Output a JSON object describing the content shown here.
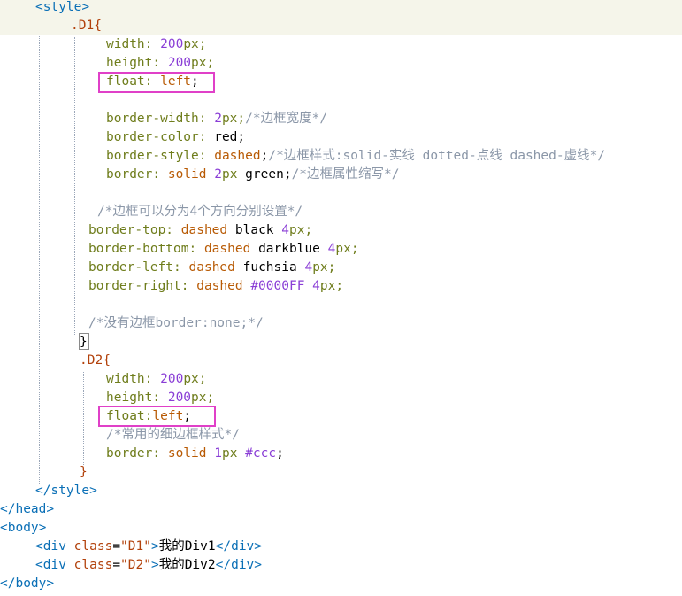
{
  "lines": [
    {
      "ind": 40,
      "hl": true,
      "tokens": [
        [
          "tag",
          "<style>"
        ]
      ]
    },
    {
      "ind": 80,
      "hl": true,
      "tokens": [
        [
          "sel",
          ".D1{"
        ]
      ]
    },
    {
      "ind": 120,
      "tokens": [
        [
          "prop",
          "width: "
        ],
        [
          "num",
          "200"
        ],
        [
          "prop",
          "px;"
        ]
      ]
    },
    {
      "ind": 120,
      "tokens": [
        [
          "prop",
          "height: "
        ],
        [
          "num",
          "200"
        ],
        [
          "prop",
          "px;"
        ]
      ]
    },
    {
      "ind": 120,
      "tokens": [
        [
          "prop",
          "float: "
        ],
        [
          "val",
          "left"
        ],
        [
          "plain",
          ";"
        ]
      ]
    },
    {
      "ind": 120,
      "tokens": []
    },
    {
      "ind": 120,
      "tokens": [
        [
          "prop",
          "border-width: "
        ],
        [
          "num",
          "2"
        ],
        [
          "prop",
          "px;"
        ],
        [
          "cm",
          "/*边框宽度*/"
        ]
      ]
    },
    {
      "ind": 120,
      "tokens": [
        [
          "prop",
          "border-color: "
        ],
        [
          "plain",
          "red;"
        ]
      ]
    },
    {
      "ind": 120,
      "tokens": [
        [
          "prop",
          "border-style: "
        ],
        [
          "val",
          "dashed"
        ],
        [
          "plain",
          ";"
        ],
        [
          "cm",
          "/*边框样式:solid-实线 dotted-点线 dashed-虚线*/"
        ]
      ]
    },
    {
      "ind": 120,
      "tokens": [
        [
          "prop",
          "border: "
        ],
        [
          "val",
          "solid "
        ],
        [
          "num",
          "2"
        ],
        [
          "prop",
          "px "
        ],
        [
          "plain",
          "green;"
        ],
        [
          "cm",
          "/*边框属性缩写*/"
        ]
      ]
    },
    {
      "ind": 120,
      "tokens": []
    },
    {
      "ind": 110,
      "tokens": [
        [
          "cm",
          "/*边框可以分为4个方向分别设置*/"
        ]
      ]
    },
    {
      "ind": 100,
      "tokens": [
        [
          "prop",
          "border-top: "
        ],
        [
          "val",
          "dashed "
        ],
        [
          "plain",
          "black "
        ],
        [
          "num",
          "4"
        ],
        [
          "prop",
          "px;"
        ]
      ]
    },
    {
      "ind": 100,
      "tokens": [
        [
          "prop",
          "border-bottom: "
        ],
        [
          "val",
          "dashed "
        ],
        [
          "plain",
          "darkblue "
        ],
        [
          "num",
          "4"
        ],
        [
          "prop",
          "px;"
        ]
      ]
    },
    {
      "ind": 100,
      "tokens": [
        [
          "prop",
          "border-left: "
        ],
        [
          "val",
          "dashed "
        ],
        [
          "plain",
          "fuchsia "
        ],
        [
          "num",
          "4"
        ],
        [
          "prop",
          "px;"
        ]
      ]
    },
    {
      "ind": 100,
      "tokens": [
        [
          "prop",
          "border-right: "
        ],
        [
          "val",
          "dashed "
        ],
        [
          "num",
          "#0000FF "
        ],
        [
          "num",
          "4"
        ],
        [
          "prop",
          "px;"
        ]
      ]
    },
    {
      "ind": 100,
      "tokens": []
    },
    {
      "ind": 100,
      "tokens": [
        [
          "cm",
          "/*没有边框border:none;*/"
        ]
      ]
    },
    {
      "ind": 90,
      "tokens": [
        [
          "plain",
          "}"
        ]
      ]
    },
    {
      "ind": 90,
      "tokens": [
        [
          "sel",
          ".D2{"
        ]
      ]
    },
    {
      "ind": 120,
      "tokens": [
        [
          "prop",
          "width: "
        ],
        [
          "num",
          "200"
        ],
        [
          "prop",
          "px;"
        ]
      ]
    },
    {
      "ind": 120,
      "tokens": [
        [
          "prop",
          "height: "
        ],
        [
          "num",
          "200"
        ],
        [
          "prop",
          "px;"
        ]
      ]
    },
    {
      "ind": 120,
      "tokens": [
        [
          "prop",
          "float:"
        ],
        [
          "val",
          "left"
        ],
        [
          "plain",
          ";"
        ]
      ]
    },
    {
      "ind": 120,
      "tokens": [
        [
          "cm",
          "/*常用的细边框样式*/"
        ]
      ]
    },
    {
      "ind": 120,
      "tokens": [
        [
          "prop",
          "border: "
        ],
        [
          "val",
          "solid "
        ],
        [
          "num",
          "1"
        ],
        [
          "prop",
          "px "
        ],
        [
          "num",
          "#ccc"
        ],
        [
          "plain",
          ";"
        ]
      ]
    },
    {
      "ind": 90,
      "tokens": [
        [
          "sel",
          "}"
        ]
      ]
    },
    {
      "ind": 40,
      "tokens": [
        [
          "tag",
          "</style>"
        ]
      ]
    },
    {
      "ind": 0,
      "tokens": [
        [
          "tag",
          "</head>"
        ]
      ]
    },
    {
      "ind": 0,
      "tokens": [
        [
          "tag",
          "<body>"
        ]
      ]
    },
    {
      "ind": 40,
      "tokens": [
        [
          "tag",
          "<div "
        ],
        [
          "attr",
          "class"
        ],
        [
          "plain",
          "="
        ],
        [
          "str",
          "\"D1\""
        ],
        [
          "tag",
          ">"
        ],
        [
          "plain",
          "我的Div1"
        ],
        [
          "tag",
          "</div>"
        ]
      ]
    },
    {
      "ind": 40,
      "tokens": [
        [
          "tag",
          "<div "
        ],
        [
          "attr",
          "class"
        ],
        [
          "plain",
          "="
        ],
        [
          "str",
          "\"D2\""
        ],
        [
          "tag",
          ">"
        ],
        [
          "plain",
          "我的Div2"
        ],
        [
          "tag",
          "</div>"
        ]
      ]
    },
    {
      "ind": 0,
      "tokens": [
        [
          "tag",
          "</body>"
        ]
      ]
    }
  ],
  "highlight_boxes": [
    {
      "line": 4,
      "label": "float-left-highlight-d1"
    },
    {
      "line": 22,
      "label": "float-left-highlight-d2"
    }
  ]
}
